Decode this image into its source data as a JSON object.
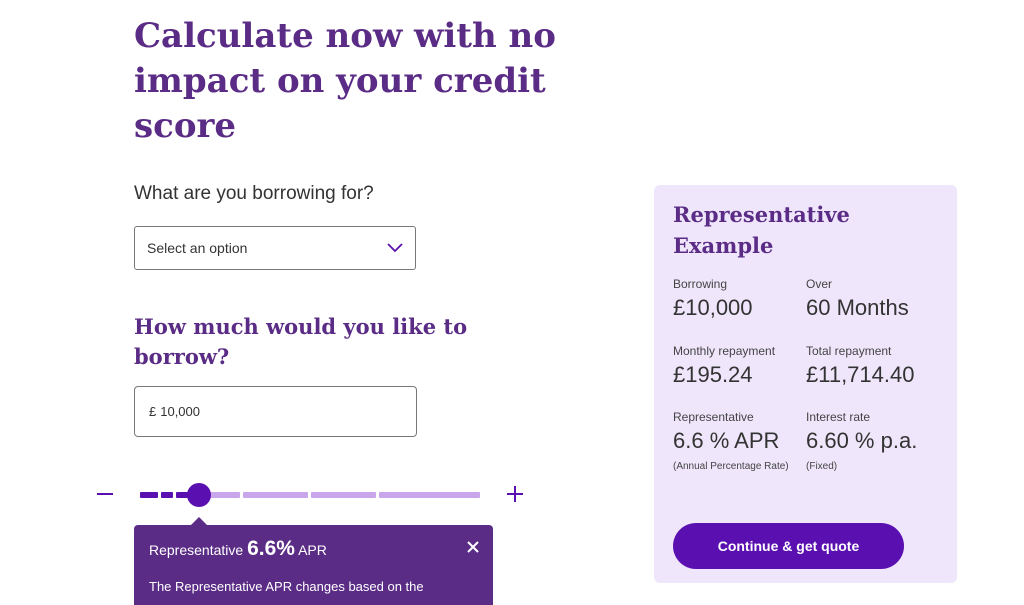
{
  "headline": "Calculate now with no impact on your credit score",
  "purpose": {
    "label": "What are you borrowing for?",
    "selected": "Select an option"
  },
  "amount": {
    "heading": "How much would you like to borrow?",
    "currency": "£",
    "value": "10,000",
    "slider": {
      "position_fraction": 0.18,
      "minus_symbol": "−",
      "plus_symbol": "+"
    }
  },
  "tooltip": {
    "prefix": "Representative",
    "rate": "6.6%",
    "suffix": "APR",
    "body": "The Representative APR changes based on the"
  },
  "representative_example": {
    "title": "Representative Example",
    "borrowing_label": "Borrowing",
    "borrowing_value": "£10,000",
    "over_label": "Over",
    "over_value": "60 Months",
    "monthly_label": "Monthly repayment",
    "monthly_value": "£195.24",
    "total_label": "Total repayment",
    "total_value": "£11,714.40",
    "apr_label": "Representative",
    "apr_value": "6.6 % APR",
    "apr_note": "(Annual Percentage Rate)",
    "interest_label": "Interest rate",
    "interest_value": "6.60 % p.a.",
    "interest_note": "(Fixed)",
    "cta_label": "Continue & get quote"
  },
  "colors": {
    "brand_purple": "#5b2c86",
    "accent_purple": "#5a0fb0",
    "track_light": "#c9a5ec",
    "panel_bg": "#efe6fb"
  },
  "icons": {
    "dropdown": "chevron-down-icon",
    "decrease": "minus-icon",
    "increase": "plus-icon",
    "close": "close-icon"
  }
}
